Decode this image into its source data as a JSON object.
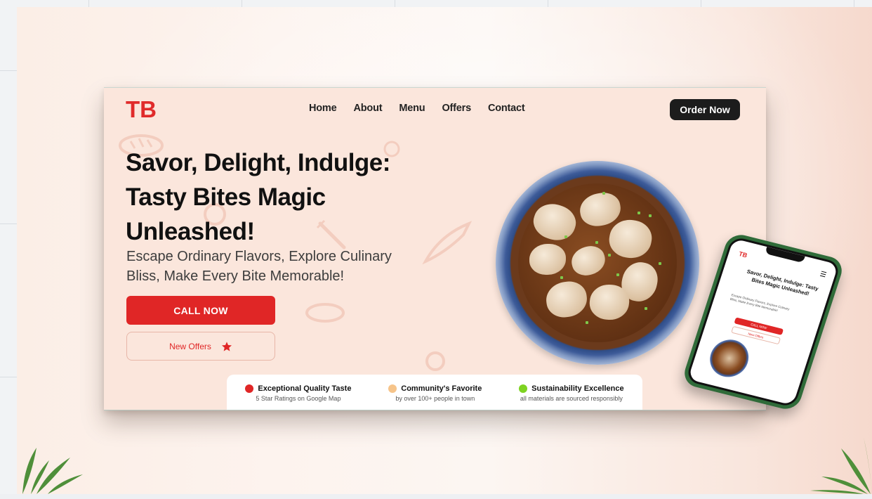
{
  "site": {
    "logo": "TB",
    "nav": [
      "Home",
      "About",
      "Menu",
      "Offers",
      "Contact"
    ],
    "order_button": "Order Now"
  },
  "hero": {
    "title": "Savor, Delight, Indulge: Tasty Bites Magic Unleashed!",
    "subtitle": "Escape Ordinary Flavors, Explore Culinary Bliss, Make Every Bite Memorable!",
    "call_button": "CALL NOW",
    "offers_button": "New Offers",
    "offers_icon": "star-icon"
  },
  "features": [
    {
      "title": "Exceptional Quality Taste",
      "desc": "5 Star Ratings on Google Map",
      "color": "#e02626"
    },
    {
      "title": "Community's Favorite",
      "desc": "by over 100+ people in town",
      "color": "#f6c48a"
    },
    {
      "title": "Sustainability Excellence",
      "desc": "all materials are sourced responsibly",
      "color": "#7ed321"
    }
  ],
  "mobile": {
    "logo": "TB",
    "menu_icon": "hamburger-menu-icon",
    "title": "Savor, Delight, Indulge: Tasty Bites Magic Unleashed!",
    "subtitle": "Escape Ordinary Flavors, Explore Culinary Bliss, Make Every Bite Memorable!",
    "call_button": "CALL NOW",
    "offers_button": "New Offers"
  },
  "colors": {
    "brand": "#e02b2b",
    "background": "#fbe6dc",
    "dark_button": "#1c1c1c",
    "phone_frame": "#2f6b39"
  }
}
